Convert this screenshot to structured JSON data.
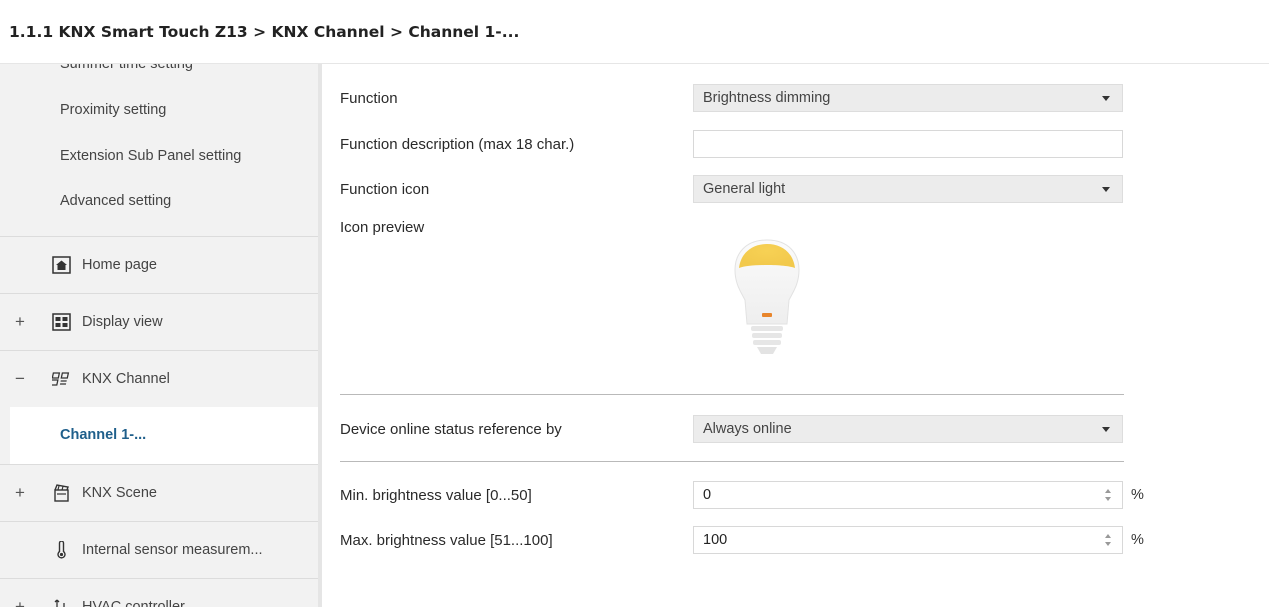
{
  "breadcrumb": "1.1.1 KNX Smart Touch Z13 > KNX Channel  > Channel 1-...",
  "sidebar": {
    "partial_item": "Summer time setting",
    "sub_items": [
      "Proximity setting",
      "Extension Sub Panel setting",
      "Advanced setting"
    ],
    "groups": {
      "home": {
        "label": "Home page",
        "toggle": "",
        "icon": "home-icon"
      },
      "display": {
        "label": "Display view",
        "toggle": "+",
        "icon": "grid-view-icon"
      },
      "channel": {
        "label": "KNX Channel",
        "toggle": "−",
        "icon": "knx-channel-icon"
      },
      "scene": {
        "label": "KNX Scene",
        "toggle": "+",
        "icon": "scene-icon"
      },
      "sensor": {
        "label": "Internal sensor measurem...",
        "toggle": "",
        "icon": "thermometer-icon"
      },
      "hvac": {
        "label": "HVAC controller",
        "toggle": "+",
        "icon": "hvac-icon"
      }
    },
    "active_item": "Channel 1-..."
  },
  "form": {
    "function": {
      "label": "Function",
      "value": "Brightness dimming"
    },
    "description": {
      "label": "Function description (max 18 char.)",
      "value": ""
    },
    "icon": {
      "label": "Function icon",
      "value": "General light"
    },
    "icon_preview": {
      "label": "Icon preview",
      "icon": "light-bulb-icon"
    },
    "online_status": {
      "label": "Device online status reference by",
      "value": "Always online"
    },
    "min_brightness": {
      "label": "Min. brightness value [0...50]",
      "value": "0",
      "unit": "%"
    },
    "max_brightness": {
      "label": "Max. brightness value [51...100]",
      "value": "100",
      "unit": "%"
    }
  },
  "colors": {
    "active_text": "#1f5f8b",
    "sidebar_bg": "#f2f2f2",
    "bulb_glow": "#f7d154",
    "bulb_indicator": "#e8852b"
  }
}
